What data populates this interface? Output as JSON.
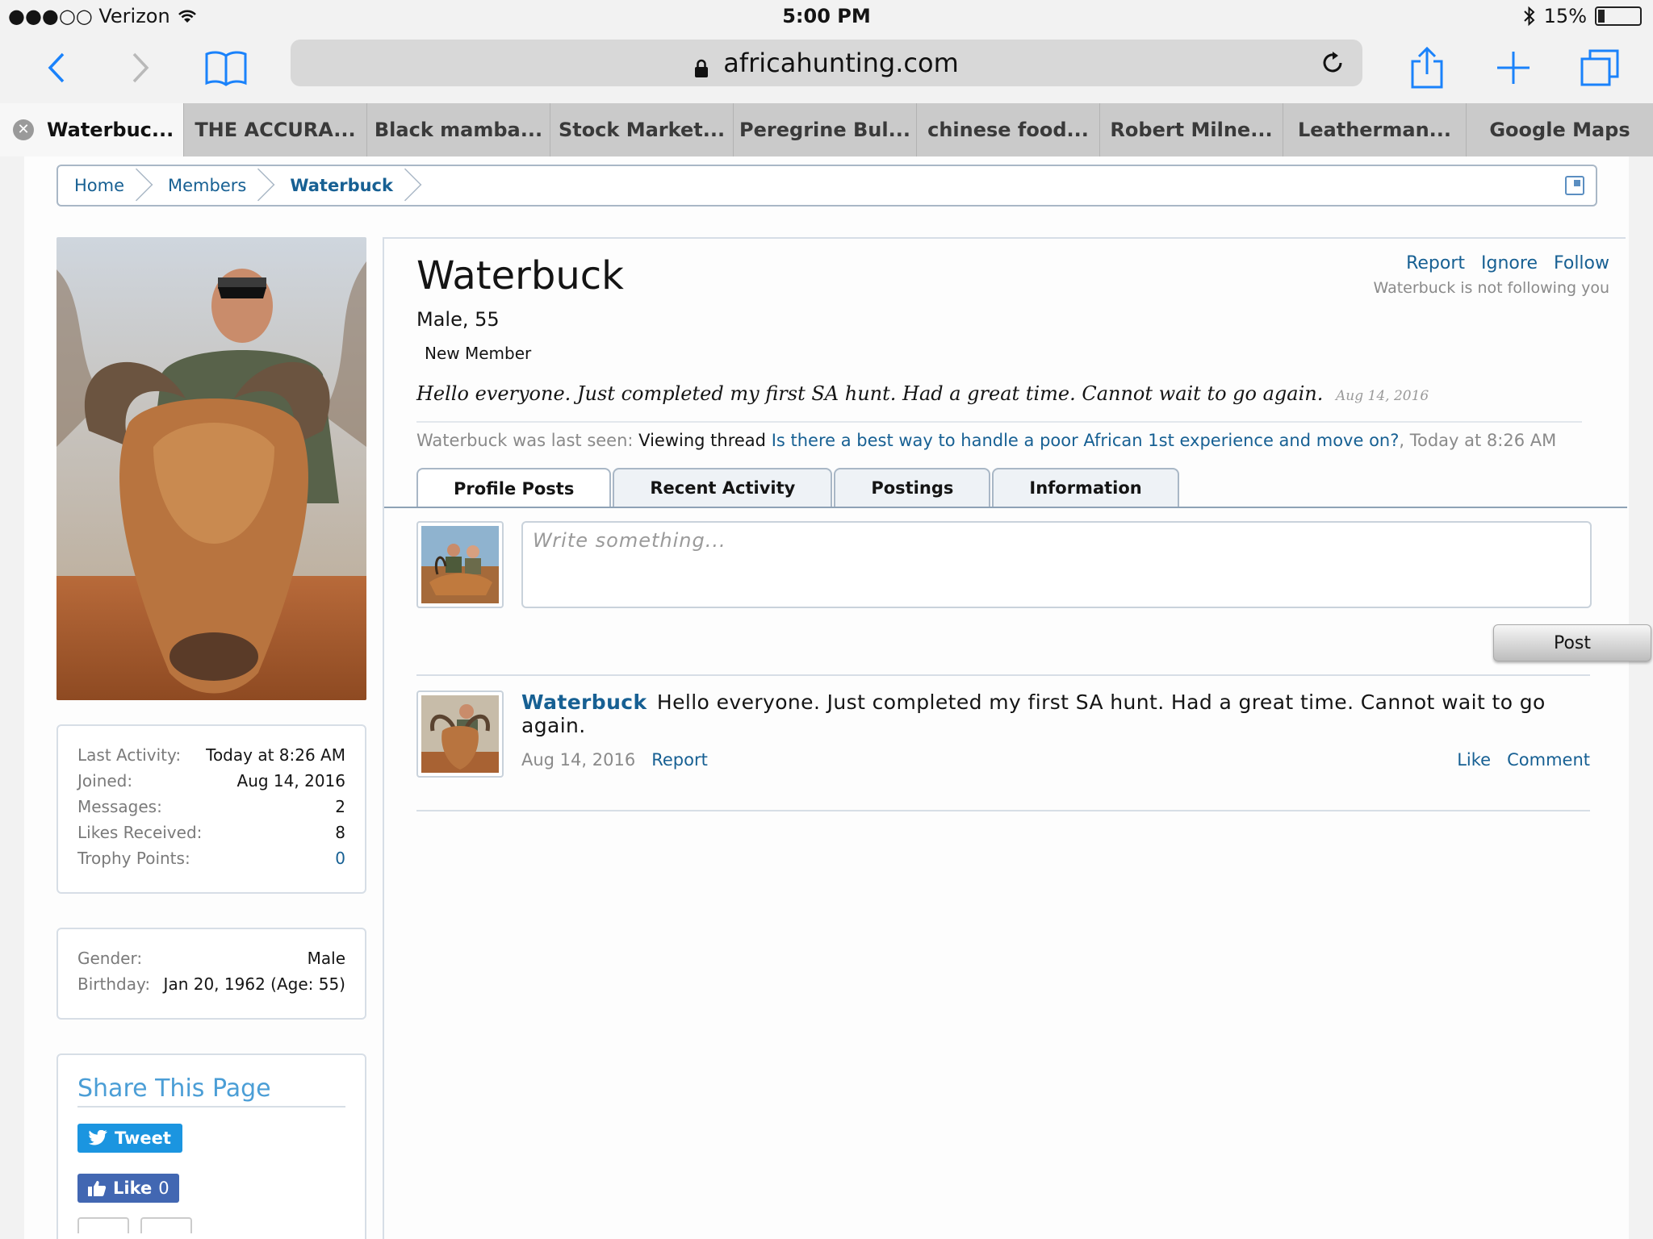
{
  "status_bar": {
    "carrier": "●●●○○ Verizon",
    "time": "5:00 PM",
    "battery": "15%",
    "battery_level": 0.15
  },
  "browser": {
    "url": "africahunting.com",
    "icons": [
      "back-icon",
      "forward-icon",
      "bookmarks-icon",
      "lock-icon",
      "reload-icon",
      "share-icon",
      "new-tab-icon",
      "tabs-icon"
    ],
    "tabs": [
      {
        "label": "Waterbuc..."
      },
      {
        "label": "THE ACCURA..."
      },
      {
        "label": "Black mamba..."
      },
      {
        "label": "Stock Market..."
      },
      {
        "label": "Peregrine Bul..."
      },
      {
        "label": "chinese food..."
      },
      {
        "label": "Robert Milne..."
      },
      {
        "label": "Leatherman..."
      },
      {
        "label": "Google Maps"
      }
    ]
  },
  "breadcrumb": [
    "Home",
    "Members",
    "Waterbuck"
  ],
  "profile": {
    "name": "Waterbuck",
    "gender_age": "Male, 55",
    "title": "New Member",
    "status": "Hello everyone. Just completed my first SA hunt. Had a great time. Cannot wait to go again.",
    "status_date": "Aug 14, 2016",
    "actions": [
      "Report",
      "Ignore",
      "Follow"
    ],
    "follow_note": "Waterbuck is not following you",
    "last_seen": {
      "prefix": "Waterbuck was last seen:",
      "activity": "Viewing thread",
      "thread": "Is there a best way to handle a poor African 1st experience and move on?",
      "time": ", Today at 8:26 AM"
    }
  },
  "stats": [
    {
      "label": "Last Activity:",
      "value": "Today at 8:26 AM"
    },
    {
      "label": "Joined:",
      "value": "Aug 14, 2016"
    },
    {
      "label": "Messages:",
      "value": "2"
    },
    {
      "label": "Likes Received:",
      "value": "8"
    },
    {
      "label": "Trophy Points:",
      "value": "0"
    }
  ],
  "info": [
    {
      "label": "Gender:",
      "value": "Male"
    },
    {
      "label": "Birthday:",
      "value": "Jan 20, 1962 (Age: 55)"
    }
  ],
  "share": {
    "title": "Share This Page",
    "tweet": "Tweet",
    "like": "Like",
    "like_count": "0"
  },
  "profile_tabs": [
    "Profile Posts",
    "Recent Activity",
    "Postings",
    "Information"
  ],
  "composer": {
    "placeholder": "Write something...",
    "post_button": "Post"
  },
  "posts": [
    {
      "author": "Waterbuck",
      "text": "Hello everyone. Just completed my first SA hunt. Had a great time. Cannot wait to go again.",
      "date": "Aug 14, 2016",
      "report": "Report",
      "like": "Like",
      "comment": "Comment"
    }
  ],
  "colors": {
    "link": "#176093",
    "share_title": "#4b9ed6",
    "tweet": "#1b95e0",
    "facebook": "#4267b2",
    "ios_blue": "#1a82fb"
  }
}
